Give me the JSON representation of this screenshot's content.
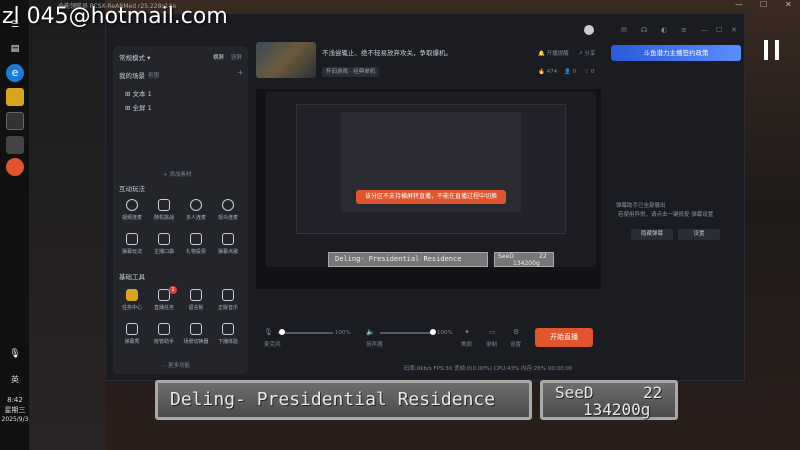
{
  "desktop": {
    "watermark_email": "zl 045@hotmail.com",
    "taskbar": {
      "lang": "英",
      "time": "8:42",
      "weekday": "星期三",
      "date": "2025/9/3"
    },
    "title_bar": "全能领航员 PCSX-ReARMed r25.228c14e"
  },
  "app": {
    "left_panel": {
      "mode_label": "常规模式",
      "landscape": "横屏",
      "portrait": "竖屏",
      "my_scene": "我的场景",
      "ambient": "氛围",
      "scenes": [
        "文本 1",
        "全屏 1"
      ],
      "add_material": "添加素材"
    },
    "interactive": {
      "title": "互动玩法",
      "items": [
        "视频连麦",
        "随机挑战",
        "多人连麦",
        "观众连麦",
        "弹幕玩法",
        "主播口袋",
        "礼物投票",
        "弹幕点歌"
      ]
    },
    "tools": {
      "title": "基础工具",
      "items": [
        "任务中心",
        "直播任务",
        "留言板",
        "正版音乐",
        "弹幕秀",
        "房管助手",
        "场景切换器",
        "下播体验"
      ],
      "badge_count": "1",
      "more": "更多功能"
    },
    "header": {
      "stream_title": "不浅尝辄止、绝不轻易放弃攻关，争取爆机。",
      "category": "怀旧游戏 · 经典单机",
      "likes": "474",
      "viewers": "0",
      "hearts": "0",
      "open_fan": "开播提醒",
      "share": "分享",
      "banner": "斗鱼潜力主播签约政策"
    },
    "preview": {
      "toast": "该分区不支持横屏转直播，不能在直播过程中切换",
      "location_label": "Deling- Presidential Residence",
      "seed_label": "SeeD",
      "seed_level": "22",
      "gil": "134200g"
    },
    "right_panel": {
      "line1": "弹幕助手已全部展出",
      "line2": "若使用异常，请点击一键修复 弹幕设置",
      "hide_btn": "隐藏弹幕",
      "settings_btn": "设置"
    },
    "bottom": {
      "mic_label": "麦克风",
      "mic_pct": "100%",
      "spk_label": "扬声器",
      "spk_pct": "100%",
      "beauty": "美颜",
      "record": "录制",
      "settings": "设置",
      "start": "开始直播",
      "status": "码率:0kb/s    FPS:30    丢帧:0(0.00%)    CPU:43%    内存:26%    00:00:00"
    }
  },
  "game": {
    "location": "Deling- Presidential Residence",
    "seed": "SeeD",
    "level": "22",
    "gil": "134200g"
  },
  "colors": {
    "accent": "#e0552d",
    "panel": "#24252b",
    "window": "#1b1c21"
  }
}
